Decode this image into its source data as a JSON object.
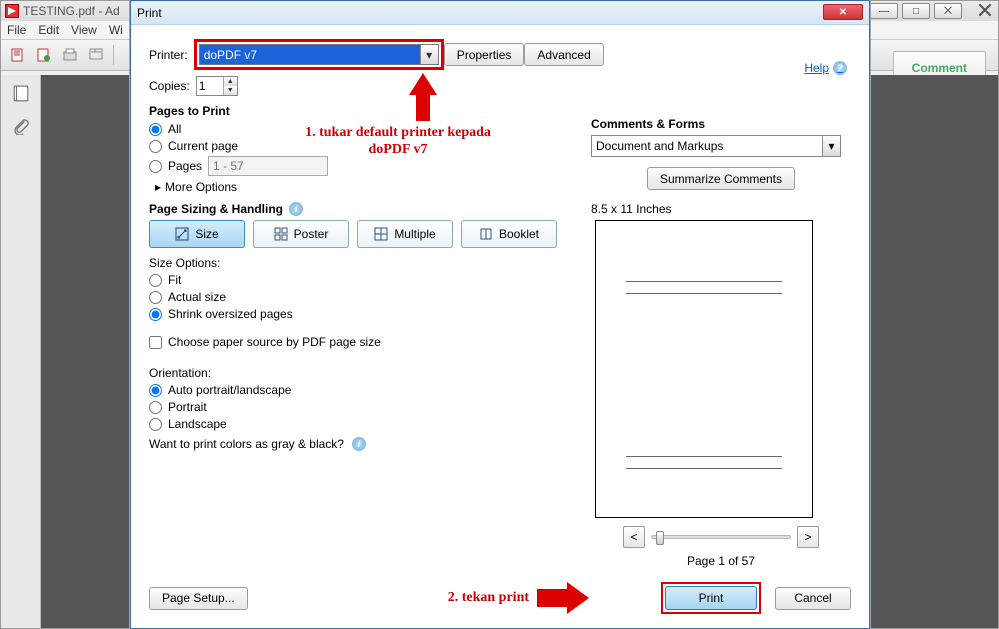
{
  "parent": {
    "title": "TESTING.pdf - Ad",
    "menu": [
      "File",
      "Edit",
      "View",
      "Wi"
    ],
    "right_btn": "Comment"
  },
  "dialog": {
    "title": "Print",
    "help": "Help",
    "printer_label": "Printer:",
    "printer_value": "doPDF v7",
    "properties": "Properties",
    "advanced": "Advanced",
    "copies_label": "Copies:",
    "copies_value": "1",
    "pages_to_print": "Pages to Print",
    "all": "All",
    "current": "Current page",
    "pages": "Pages",
    "pages_range": "1 - 57",
    "more_options": "More Options",
    "sizing_title": "Page Sizing & Handling",
    "tabs": {
      "size": "Size",
      "poster": "Poster",
      "multiple": "Multiple",
      "booklet": "Booklet"
    },
    "size_options": "Size Options:",
    "fit": "Fit",
    "actual": "Actual size",
    "shrink": "Shrink oversized pages",
    "choose_paper": "Choose paper source by PDF page size",
    "orientation": "Orientation:",
    "auto": "Auto portrait/landscape",
    "portrait": "Portrait",
    "landscape": "Landscape",
    "gray_q": "Want to print colors as gray & black?",
    "comments_forms": "Comments & Forms",
    "cf_value": "Document and Markups",
    "summarize": "Summarize Comments",
    "preview_dim": "8.5 x 11 Inches",
    "page_of": "Page 1 of 57",
    "page_setup": "Page Setup...",
    "print": "Print",
    "cancel": "Cancel"
  },
  "annotations": {
    "a1": "1. tukar default printer kepada doPDF v7",
    "a2": "2. tekan print"
  }
}
